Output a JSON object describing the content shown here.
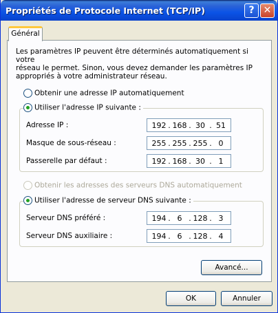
{
  "window": {
    "title": "Propriétés de Protocole Internet (TCP/IP)",
    "help_glyph": "?",
    "close_glyph": "✕"
  },
  "tabs": [
    {
      "label": "Général",
      "active": true
    }
  ],
  "intro_text": "Les paramètres IP peuvent être déterminés automatiquement si votre\nréseau le permet. Sinon, vous devez demander les paramètres IP\nappropriés à votre administrateur réseau.",
  "ip_mode": {
    "auto_label": "Obtenir une adresse IP automatiquement",
    "manual_label": "Utiliser l'adresse IP suivante :",
    "selected": "manual"
  },
  "ip_fields": [
    {
      "label": "Adresse IP :",
      "octets": [
        "192",
        "168",
        "30",
        "51"
      ]
    },
    {
      "label": "Masque de sous-réseau :",
      "octets": [
        "255",
        "255",
        "255",
        "0"
      ]
    },
    {
      "label": "Passerelle par défaut :",
      "octets": [
        "192",
        "168",
        "30",
        "1"
      ]
    }
  ],
  "dns_mode": {
    "auto_label": "Obtenir les adresses des serveurs DNS automatiquement",
    "auto_disabled": true,
    "manual_label": "Utiliser l'adresse de serveur DNS suivante :",
    "selected": "manual"
  },
  "dns_fields": [
    {
      "label": "Serveur DNS préféré :",
      "octets": [
        "194",
        "6",
        "128",
        "3"
      ]
    },
    {
      "label": "Serveur DNS auxiliaire :",
      "octets": [
        "194",
        "6",
        "128",
        "4"
      ]
    }
  ],
  "buttons": {
    "advanced": "Avancé...",
    "ok": "OK",
    "cancel": "Annuler"
  },
  "colors": {
    "titlebar": "#0b53e6",
    "dialog_bg": "#ece9d8",
    "radio_dot": "#21a121",
    "tab_highlight": "#ffc83c"
  }
}
